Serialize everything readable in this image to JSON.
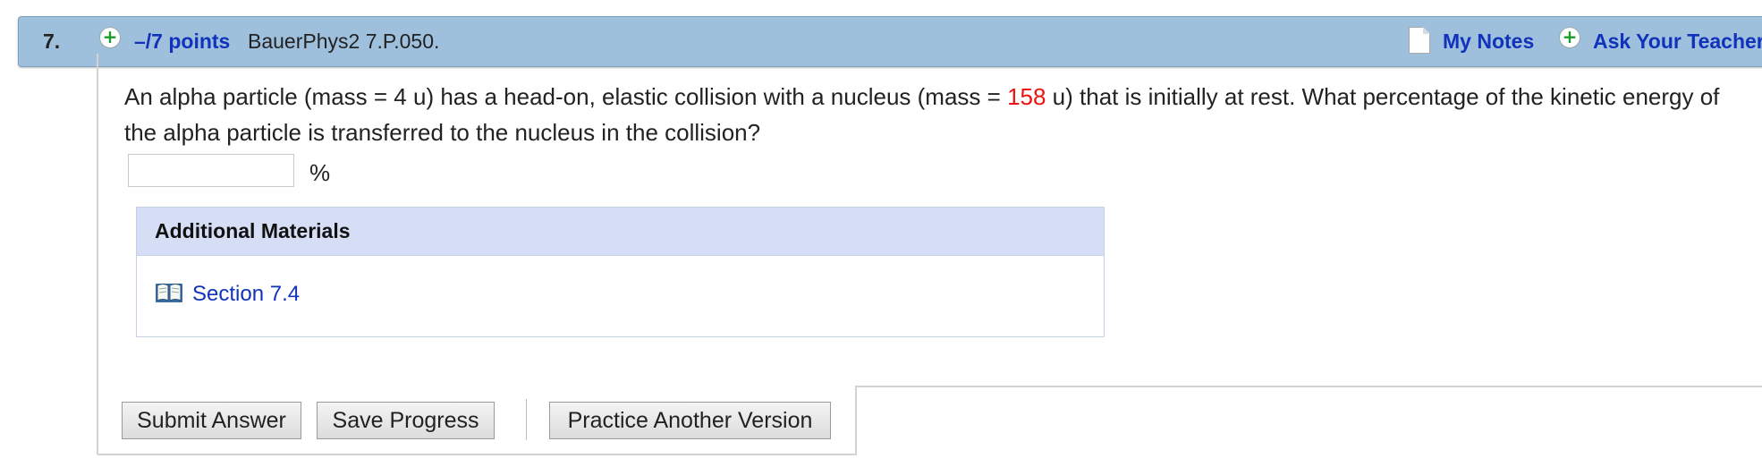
{
  "header": {
    "question_number": "7.",
    "points_label": "–/7 points",
    "problem_code": "BauerPhys2 7.P.050.",
    "my_notes_label": "My Notes",
    "ask_teacher_label": "Ask Your Teacher"
  },
  "question": {
    "text_before": "An alpha particle (mass = 4 u) has a head-on, elastic collision with a nucleus (mass = ",
    "mass_value": "158",
    "text_after": " u) that is initially at rest. What percentage of the kinetic energy of the alpha particle is transferred to the nucleus in the collision?",
    "answer_value": "",
    "answer_unit": "%"
  },
  "additional_materials": {
    "title": "Additional Materials",
    "link_label": "Section 7.4"
  },
  "actions": {
    "submit_label": "Submit Answer",
    "save_label": "Save Progress",
    "practice_label": "Practice Another Version"
  },
  "icons": {
    "expand": "plus-circle-icon",
    "notes": "document-icon",
    "ask": "plus-circle-icon",
    "materials": "book-icon"
  },
  "colors": {
    "header_bg": "#9fc0dc",
    "link": "#1133bb",
    "highlight": "#ee1111",
    "materials_header_bg": "#d6def6"
  }
}
